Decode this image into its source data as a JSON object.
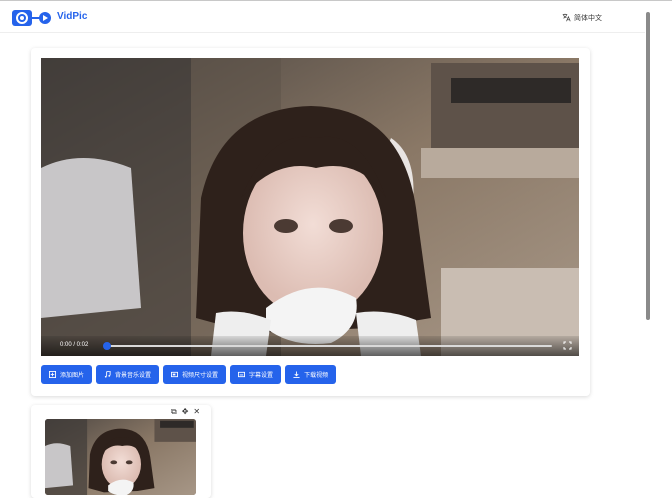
{
  "header": {
    "brand": "VidPic",
    "language": "简体中文"
  },
  "player": {
    "time": "0:00 / 0:02",
    "progress": 0
  },
  "toolbar": {
    "buttons": [
      {
        "label": "添加图片",
        "icon": "image-add-icon"
      },
      {
        "label": "背景音乐设置",
        "icon": "music-icon"
      },
      {
        "label": "视频尺寸设置",
        "icon": "resize-icon"
      },
      {
        "label": "字幕设置",
        "icon": "subtitle-icon"
      },
      {
        "label": "下载视频",
        "icon": "download-icon"
      }
    ]
  },
  "thumbnail": {
    "tools": [
      "copy-icon",
      "move-icon",
      "close-icon"
    ],
    "glyphs": {
      "copy": "⧉",
      "move": "✥",
      "close": "✕"
    }
  },
  "colors": {
    "accent": "#2563eb"
  }
}
